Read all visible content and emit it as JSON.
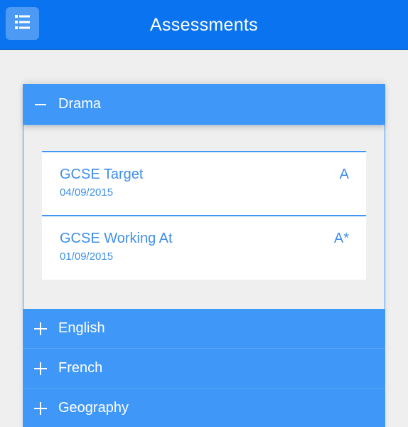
{
  "appbar": {
    "title": "Assessments",
    "menu_icon": "list-icon",
    "color": "#0a74f0"
  },
  "accordion": {
    "accent": "#3f97f7",
    "sections": [
      {
        "label": "Drama",
        "expanded": true,
        "items": [
          {
            "name": "GCSE Target",
            "date": "04/09/2015",
            "grade": "A"
          },
          {
            "name": "GCSE Working At",
            "date": "01/09/2015",
            "grade": "A*"
          }
        ]
      },
      {
        "label": "English",
        "expanded": false
      },
      {
        "label": "French",
        "expanded": false
      },
      {
        "label": "Geography",
        "expanded": false
      }
    ]
  }
}
